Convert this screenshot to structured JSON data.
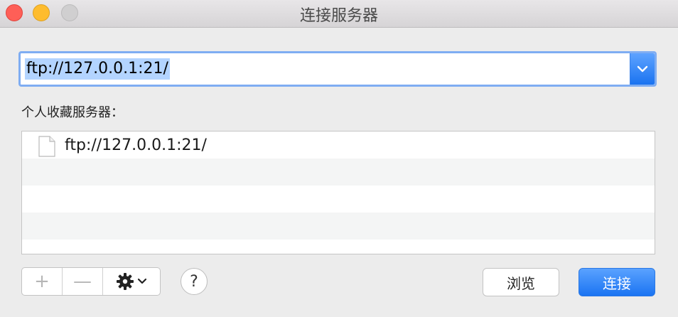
{
  "window": {
    "title": "连接服务器"
  },
  "server_address": {
    "value": "ftp://127.0.0.1:21/"
  },
  "favorites": {
    "label": "个人收藏服务器：",
    "items": [
      {
        "label": "ftp://127.0.0.1:21/",
        "icon": "document-icon"
      }
    ]
  },
  "toolbar": {
    "add_label": "+",
    "remove_label": "—",
    "help_label": "?"
  },
  "buttons": {
    "browse_label": "浏览",
    "connect_label": "连接"
  },
  "colors": {
    "accent": "#1b74f2",
    "selection": "#b3d4ff",
    "close": "#fe5f57",
    "minimize": "#febc2e"
  }
}
